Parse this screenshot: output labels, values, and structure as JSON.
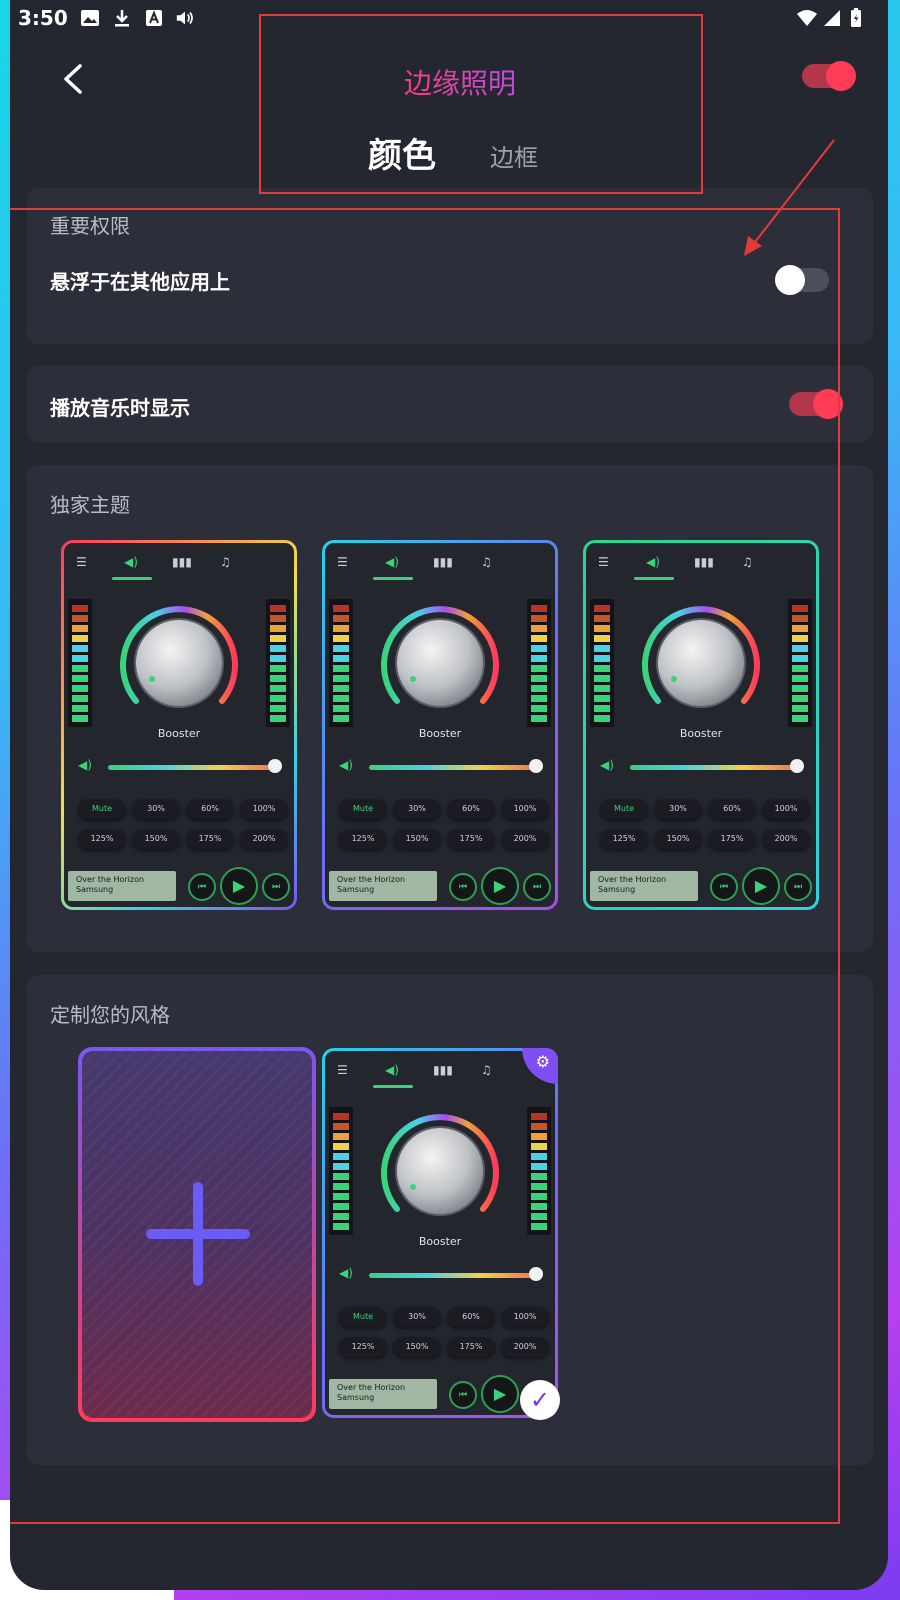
{
  "status_bar": {
    "time": "3:50"
  },
  "header": {
    "title": "边缘照明",
    "tabs": [
      {
        "label": "颜色",
        "active": true
      },
      {
        "label": "边框",
        "active": false
      }
    ],
    "master_toggle_on": true
  },
  "permissions": {
    "section_title": "重要权限",
    "overlay_label": "悬浮于在其他应用上",
    "overlay_on": false
  },
  "music": {
    "label": "播放音乐时显示",
    "on": true
  },
  "themes": {
    "section_title": "独家主题",
    "preview": {
      "booster": "Booster",
      "presets": [
        "Mute",
        "30%",
        "60%",
        "100%",
        "125%",
        "150%",
        "175%",
        "200%"
      ],
      "track_title": "Over the Horizon",
      "track_artist": "Samsung"
    }
  },
  "custom": {
    "section_title": "定制您的风格"
  },
  "colors": {
    "accent": "#ff3c55",
    "card": "#2c2f39",
    "background": "#242730",
    "equalizer_green": "#3ad37a"
  }
}
